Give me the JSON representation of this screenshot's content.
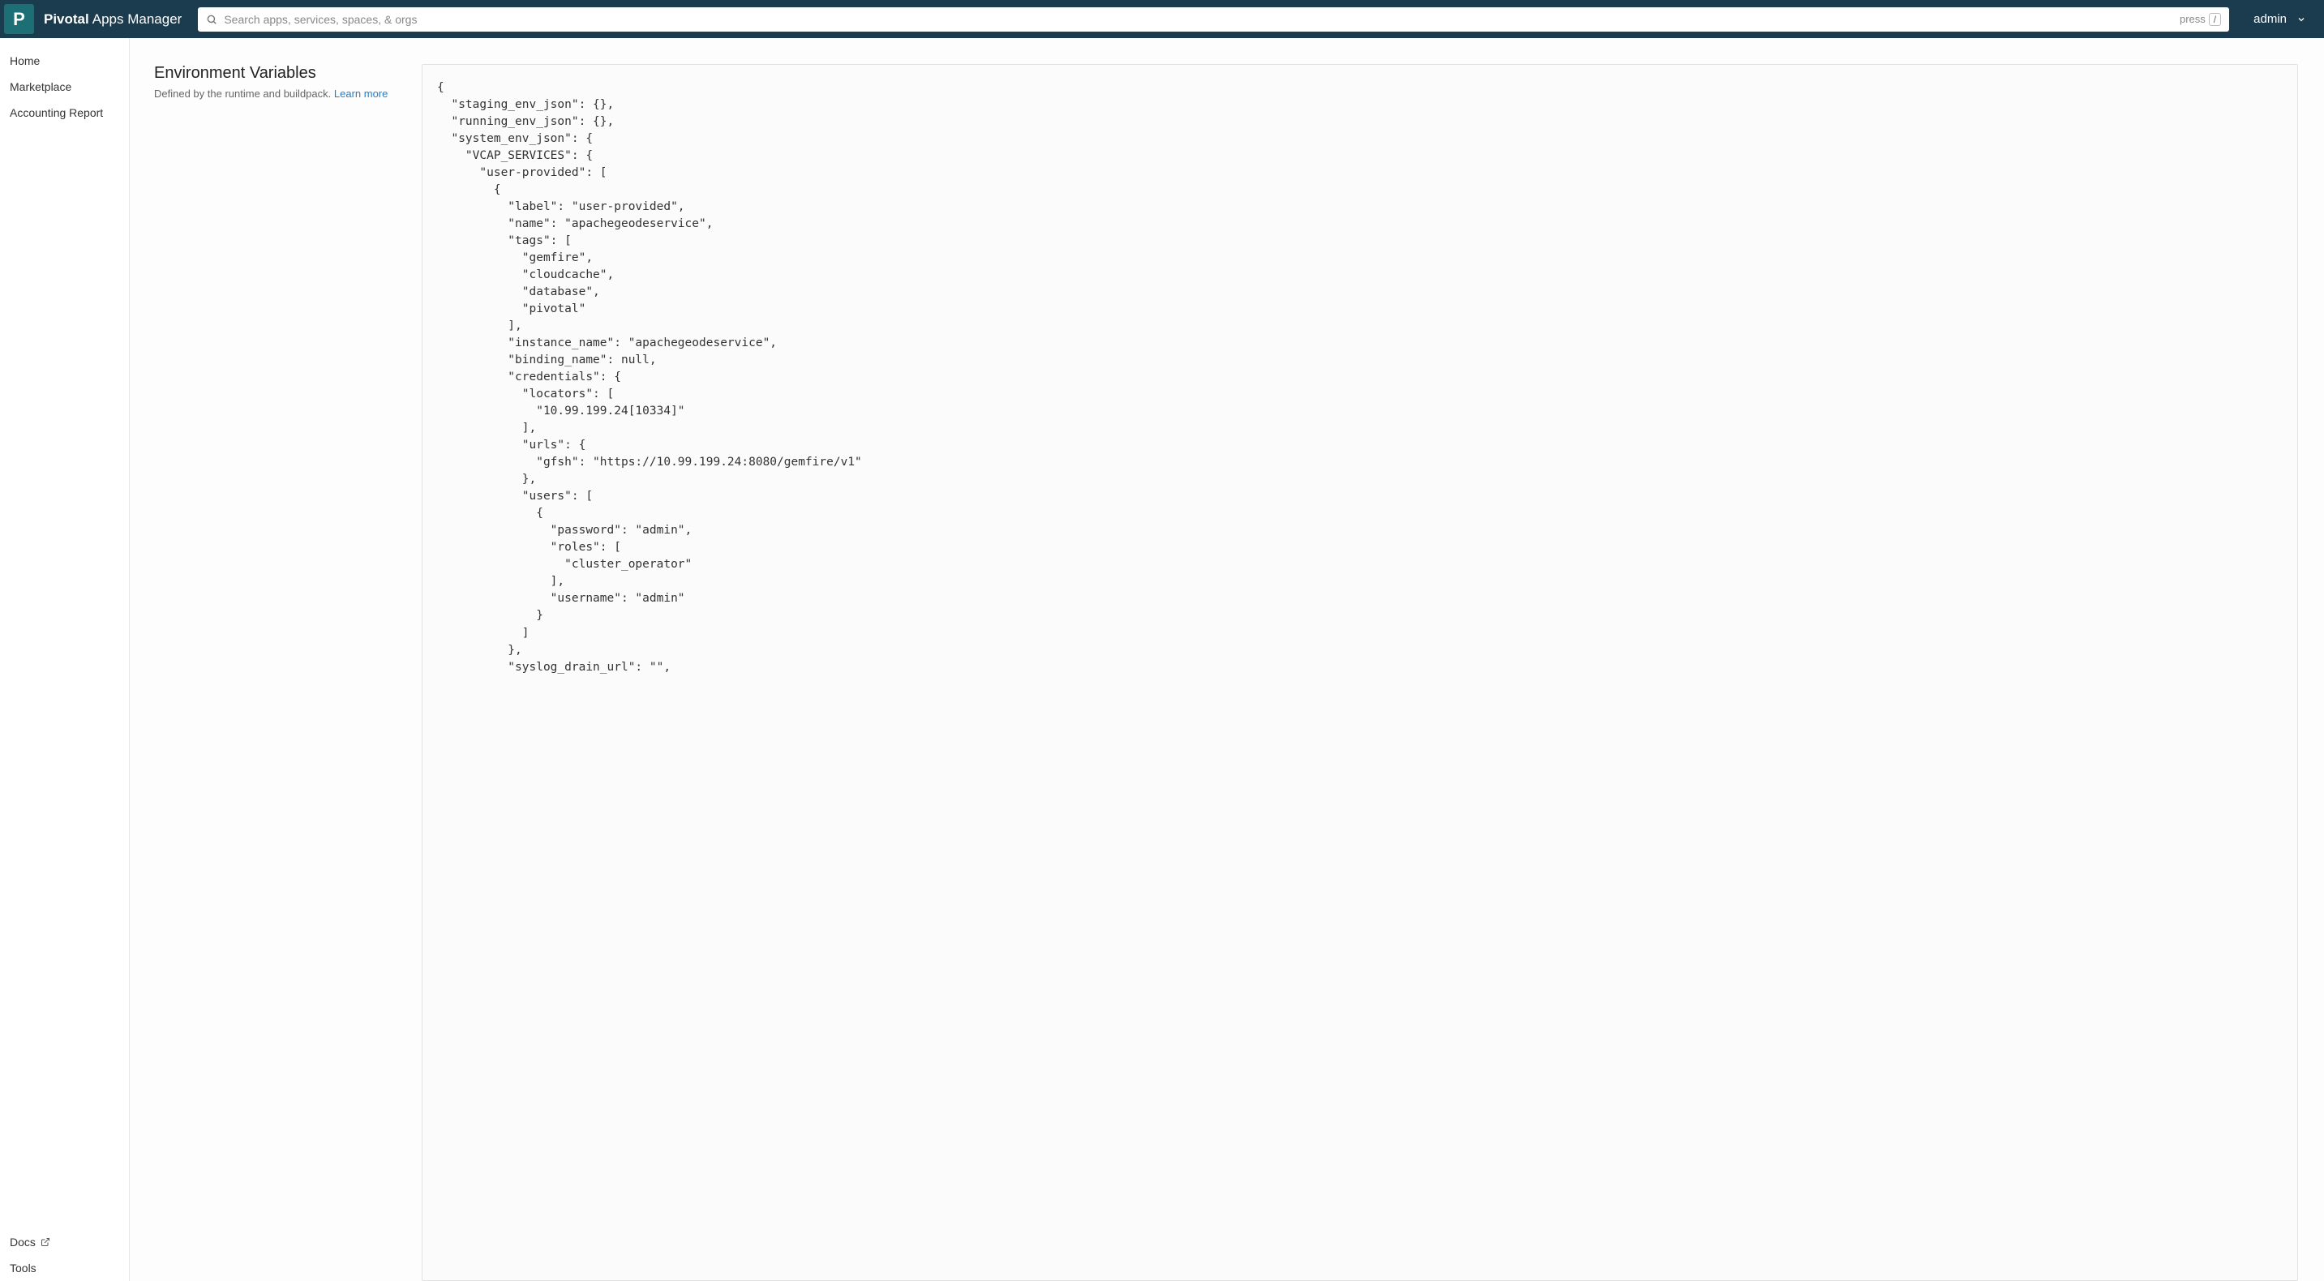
{
  "header": {
    "logo_letter": "P",
    "brand_bold": "Pivotal",
    "brand_light": "Apps Manager",
    "search_placeholder": "Search apps, services, spaces, & orgs",
    "press_label": "press",
    "press_key": "/",
    "user": "admin"
  },
  "sidebar": {
    "items": [
      {
        "label": "Home"
      },
      {
        "label": "Marketplace"
      },
      {
        "label": "Accounting Report"
      }
    ],
    "bottom": [
      {
        "label": "Docs",
        "external": true
      },
      {
        "label": "Tools",
        "external": false
      }
    ]
  },
  "main": {
    "title": "Environment Variables",
    "subtitle": "Defined by the runtime and buildpack.",
    "learn_more": "Learn more",
    "env_json": "{\n  \"staging_env_json\": {},\n  \"running_env_json\": {},\n  \"system_env_json\": {\n    \"VCAP_SERVICES\": {\n      \"user-provided\": [\n        {\n          \"label\": \"user-provided\",\n          \"name\": \"apachegeodeservice\",\n          \"tags\": [\n            \"gemfire\",\n            \"cloudcache\",\n            \"database\",\n            \"pivotal\"\n          ],\n          \"instance_name\": \"apachegeodeservice\",\n          \"binding_name\": null,\n          \"credentials\": {\n            \"locators\": [\n              \"10.99.199.24[10334]\"\n            ],\n            \"urls\": {\n              \"gfsh\": \"https://10.99.199.24:8080/gemfire/v1\"\n            },\n            \"users\": [\n              {\n                \"password\": \"admin\",\n                \"roles\": [\n                  \"cluster_operator\"\n                ],\n                \"username\": \"admin\"\n              }\n            ]\n          },\n          \"syslog_drain_url\": \"\","
  }
}
